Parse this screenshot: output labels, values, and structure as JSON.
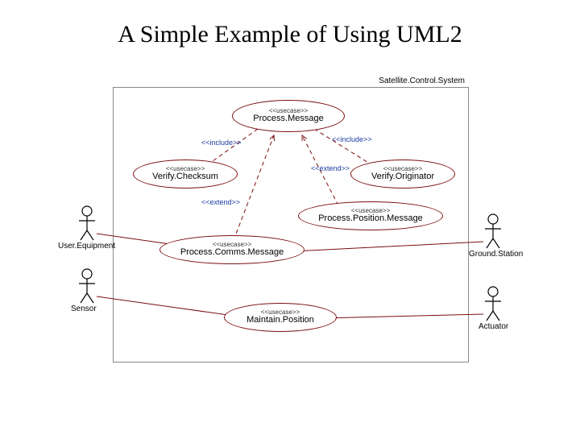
{
  "title": "A Simple Example of Using UML2",
  "system_name": "Satellite.Control.System",
  "stereotypes": {
    "usecase": "<<usecase>>",
    "include": "<<include>>",
    "extend": "<<extend>>"
  },
  "usecases": {
    "process_message": "Process.Message",
    "verify_checksum": "Verify.Checksum",
    "verify_originator": "Verify.Originator",
    "process_position_message": "Process.Position.Message",
    "process_comms_message": "Process.Comms.Message",
    "maintain_position": "Maintain.Position"
  },
  "actors": {
    "user_equipment": "User.Equipment",
    "sensor": "Sensor",
    "ground_station": "Ground.Station",
    "actuator": "Actuator"
  },
  "relationships": [
    {
      "from": "process_message",
      "to": "verify_checksum",
      "type": "include"
    },
    {
      "from": "process_message",
      "to": "verify_originator",
      "type": "include"
    },
    {
      "from": "process_position_message",
      "to": "process_message",
      "type": "extend"
    },
    {
      "from": "process_comms_message",
      "to": "process_message",
      "type": "extend"
    },
    {
      "from": "user_equipment",
      "to": "process_comms_message",
      "type": "association"
    },
    {
      "from": "ground_station",
      "to": "process_comms_message",
      "type": "association"
    },
    {
      "from": "sensor",
      "to": "maintain_position",
      "type": "association"
    },
    {
      "from": "actuator",
      "to": "maintain_position",
      "type": "association"
    }
  ]
}
